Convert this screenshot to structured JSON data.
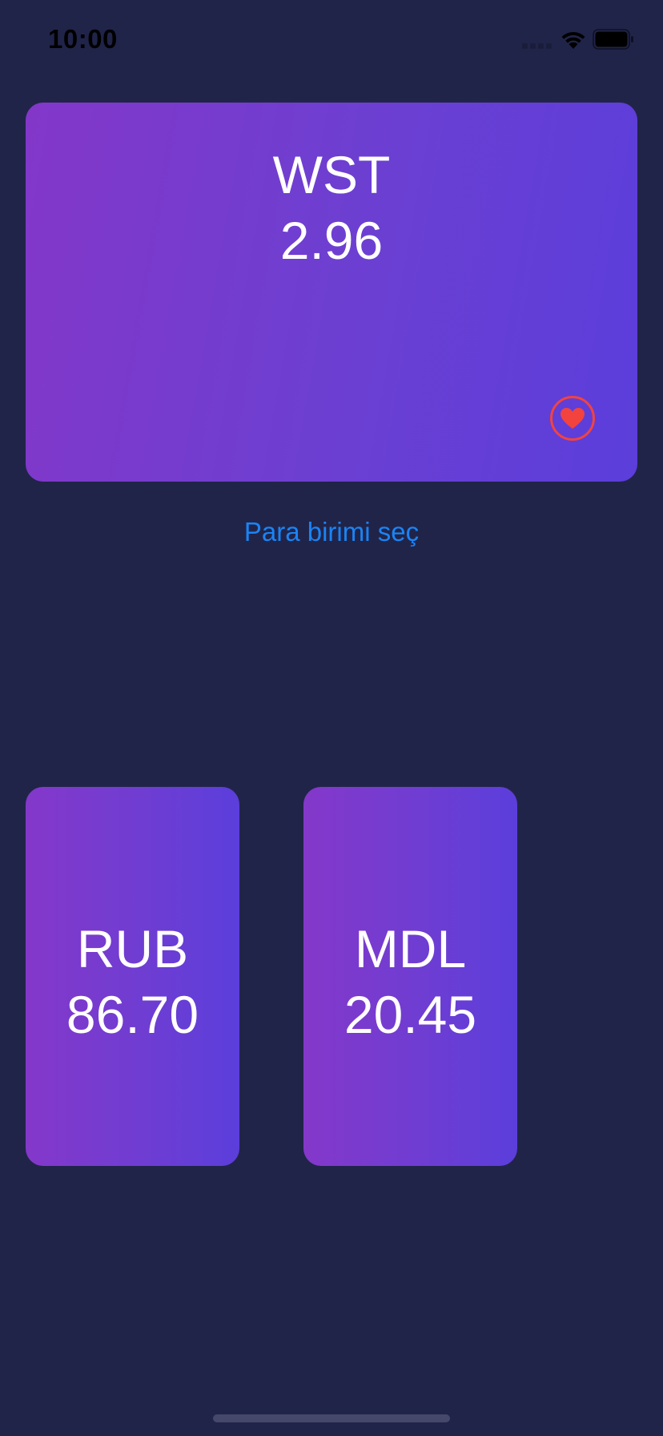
{
  "status_bar": {
    "time": "10:00"
  },
  "main_card": {
    "currency_code": "WST",
    "rate": "2.96",
    "favorite_icon": "heart-icon",
    "favorite_color": "#f2433f"
  },
  "select_currency": {
    "label": "Para birimi seç",
    "color": "#1a84f5"
  },
  "currency_cards": [
    {
      "currency_code": "RUB",
      "rate": "86.70"
    },
    {
      "currency_code": "MDL",
      "rate": "20.45"
    }
  ],
  "colors": {
    "background": "#212449",
    "card_gradient_start": "#8337c9",
    "card_gradient_end": "#5b3edb"
  }
}
